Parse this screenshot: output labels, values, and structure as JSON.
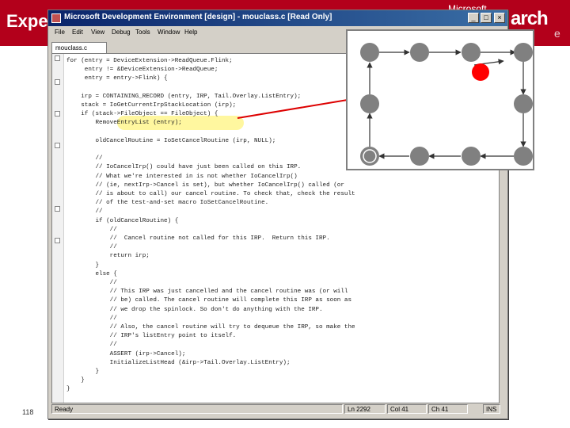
{
  "slide": {
    "title": "Expe",
    "brand_top": "Microsoft",
    "brand_main": "arch",
    "brand_sub": "e",
    "slide_number": "118"
  },
  "window": {
    "title": "Microsoft Development Environment [design] - mouclass.c [Read Only]",
    "buttons": {
      "minimize": "_",
      "maximize": "□",
      "close": "×"
    }
  },
  "menu": [
    "File",
    "Edit",
    "View",
    "Debug",
    "Tools",
    "Window",
    "Help"
  ],
  "tab": {
    "label": "mouclass.c"
  },
  "code_lines": [
    "for (entry = DeviceExtension->ReadQueue.Flink;",
    "     entry != &DeviceExtension->ReadQueue;",
    "     entry = entry->Flink) {",
    "",
    "    irp = CONTAINING_RECORD (entry, IRP, Tail.Overlay.ListEntry);",
    "    stack = IoGetCurrentIrpStackLocation (irp);",
    "    if (stack->FileObject == FileObject) {",
    "        RemoveEntryList (entry);",
    "",
    "        oldCancelRoutine = IoSetCancelRoutine (irp, NULL);",
    "",
    "        //",
    "        // IoCancelIrp() could have just been called on this IRP.",
    "        // What we're interested in is not whether IoCancelIrp()",
    "        // (ie, nextIrp->Cancel is set), but whether IoCancelIrp() called (or",
    "        // is about to call) our cancel routine. To check that, check the result",
    "        // of the test-and-set macro IoSetCancelRoutine.",
    "        //",
    "        if (oldCancelRoutine) {",
    "            //",
    "            //  Cancel routine not called for this IRP.  Return this IRP.",
    "            //",
    "            return irp;",
    "        }",
    "        else {",
    "            //",
    "            // This IRP was just cancelled and the cancel routine was (or will",
    "            // be) called. The cancel routine will complete this IRP as soon as",
    "            // we drop the spinlock. So don't do anything with the IRP.",
    "            //",
    "            // Also, the cancel routine will try to dequeue the IRP, so make the",
    "            // IRP's listEntry point to itself.",
    "            //",
    "            ASSERT (irp->Cancel);",
    "            InitializeListHead (&irp->Tail.Overlay.ListEntry);",
    "        }",
    "    }",
    "}"
  ],
  "status": {
    "ready": "Ready",
    "line": "Ln 2292",
    "col": "Col 41",
    "ch": "Ch 41",
    "ins": "INS"
  },
  "colors": {
    "slide_red": "#b3001b",
    "node_gray": "#808080",
    "node_active": "#ff0000",
    "pointer_red": "#dd0000"
  }
}
